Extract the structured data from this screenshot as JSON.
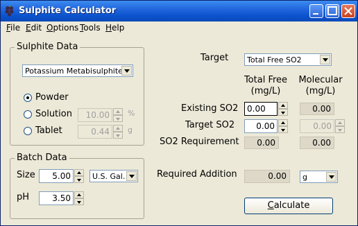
{
  "window": {
    "title": "Sulphite Calculator"
  },
  "menu": [
    {
      "prefix": "",
      "accel": "F",
      "rest": "ile"
    },
    {
      "prefix": "",
      "accel": "E",
      "rest": "dit"
    },
    {
      "prefix": "",
      "accel": "O",
      "rest": "ptions"
    },
    {
      "prefix": "",
      "accel": "T",
      "rest": "ools"
    },
    {
      "prefix": "",
      "accel": "H",
      "rest": "elp"
    }
  ],
  "sulphite_data": {
    "legend": "Sulphite Data",
    "compound": "Potassium Metabisulphite",
    "form_options": [
      {
        "label": "Powder",
        "checked": true,
        "value": "",
        "unit": ""
      },
      {
        "label": "Solution",
        "checked": false,
        "value": "10.00",
        "unit": "%"
      },
      {
        "label": "Tablet",
        "checked": false,
        "value": "0.44",
        "unit": "g"
      }
    ]
  },
  "batch_data": {
    "legend": "Batch Data",
    "size_label": "Size",
    "size_value": "5.00",
    "size_unit": "U.S. Gal.",
    "ph_label": "pH",
    "ph_value": "3.50"
  },
  "target": {
    "label": "Target",
    "selected": "Total Free SO2",
    "col_total_line1": "Total Free",
    "col_total_line2": "(mg/L)",
    "col_mol_line1": "Molecular",
    "col_mol_line2": "(mg/L)",
    "existing_label": "Existing SO2",
    "existing_total": "0.00",
    "existing_mol": "0.00",
    "target_label": "Target SO2",
    "target_total": "0.00",
    "target_mol": "0.00",
    "req_label": "SO2 Requirement",
    "req_total": "0.00",
    "req_mol": "0.00",
    "required_label": "Required Addition",
    "required_value": "0.00",
    "required_unit": "g",
    "calculate_prefix": "",
    "calculate_accel": "C",
    "calculate_rest": "alculate"
  }
}
